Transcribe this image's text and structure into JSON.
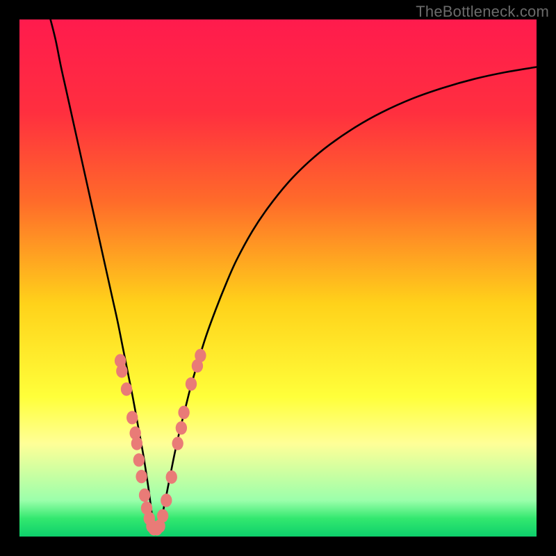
{
  "watermark": "TheBottleneck.com",
  "chart_data": {
    "type": "line",
    "title": "",
    "xlabel": "",
    "ylabel": "",
    "xlim": [
      0,
      100
    ],
    "ylim": [
      0,
      100
    ],
    "x_opt": 26,
    "gradient_stops": [
      {
        "offset": 0.0,
        "color": "#ff1b4d"
      },
      {
        "offset": 0.18,
        "color": "#ff2f3f"
      },
      {
        "offset": 0.35,
        "color": "#ff6a2a"
      },
      {
        "offset": 0.55,
        "color": "#ffd21a"
      },
      {
        "offset": 0.73,
        "color": "#ffff3a"
      },
      {
        "offset": 0.82,
        "color": "#ffff97"
      },
      {
        "offset": 0.93,
        "color": "#9bffab"
      },
      {
        "offset": 0.965,
        "color": "#33e86f"
      },
      {
        "offset": 1.0,
        "color": "#0dcf6b"
      }
    ],
    "series": [
      {
        "name": "bottleneck-curve",
        "x": [
          6,
          7,
          8,
          9,
          10,
          11,
          12,
          13,
          14,
          15,
          16,
          17,
          18,
          19,
          20,
          21,
          22,
          23,
          24,
          25,
          26,
          27,
          28,
          29,
          30,
          31,
          32,
          33,
          34,
          36,
          38,
          40,
          42,
          45,
          48,
          52,
          56,
          60,
          65,
          70,
          76,
          82,
          88,
          94,
          100
        ],
        "y": [
          100,
          96,
          91,
          86.5,
          82,
          77.5,
          73,
          68.5,
          64,
          59.5,
          55,
          50.5,
          46,
          41.5,
          36.5,
          31.5,
          26.5,
          21,
          15.5,
          9,
          2,
          1.5,
          6,
          11,
          16,
          20.5,
          24.5,
          28.5,
          32,
          38.5,
          44,
          49,
          53.5,
          59,
          63.5,
          68.5,
          72.5,
          75.8,
          79.2,
          82,
          84.7,
          86.8,
          88.5,
          89.8,
          90.8
        ]
      }
    ],
    "markers": {
      "name": "sample-points",
      "color": "#e97b77",
      "rx": 1.1,
      "ry": 1.3,
      "points": [
        {
          "x": 19.5,
          "y": 34.0
        },
        {
          "x": 19.8,
          "y": 32.0
        },
        {
          "x": 20.7,
          "y": 28.5
        },
        {
          "x": 21.8,
          "y": 23.0
        },
        {
          "x": 22.4,
          "y": 20.0
        },
        {
          "x": 22.7,
          "y": 18.0
        },
        {
          "x": 23.1,
          "y": 14.8
        },
        {
          "x": 23.6,
          "y": 11.6
        },
        {
          "x": 24.2,
          "y": 8.0
        },
        {
          "x": 24.6,
          "y": 5.5
        },
        {
          "x": 25.1,
          "y": 3.5
        },
        {
          "x": 25.6,
          "y": 2.0
        },
        {
          "x": 26.0,
          "y": 1.5
        },
        {
          "x": 26.6,
          "y": 1.5
        },
        {
          "x": 27.1,
          "y": 2.0
        },
        {
          "x": 27.7,
          "y": 4.0
        },
        {
          "x": 28.4,
          "y": 7.0
        },
        {
          "x": 29.4,
          "y": 11.5
        },
        {
          "x": 30.6,
          "y": 18.0
        },
        {
          "x": 31.3,
          "y": 21.0
        },
        {
          "x": 31.8,
          "y": 24.0
        },
        {
          "x": 33.2,
          "y": 29.5
        },
        {
          "x": 34.4,
          "y": 33.0
        },
        {
          "x": 35.0,
          "y": 35.0
        }
      ]
    }
  }
}
